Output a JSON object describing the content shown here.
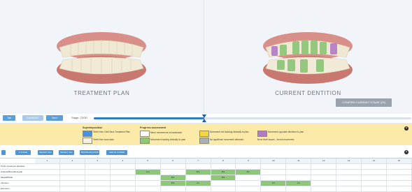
{
  "viewer": {
    "left_label": "TREATMENT PLAN",
    "right_label": "CURRENT DENTITION",
    "confirm_button": "CONFIRM CURRENT STAGE (23)"
  },
  "nav": {
    "btn1": "Tab",
    "btn2": "CURRENT",
    "btn3": "Next",
    "stage_label": "Stage: 23/30"
  },
  "legend": {
    "superimposition_title": "Superimposition",
    "superimposition_items": [
      "Teeth from ClinCheck Treatment Plan",
      "Teeth from scan data"
    ],
    "progress_title": "Progress assessment",
    "progress_items": [
      "Minor movements not assessed",
      "Movement tracking clinically to plan",
      "Movement not tracking clinically to plan",
      "No significant movement detected",
      "Movement opposite direction to plan",
      "Bone level issues - forced movement"
    ],
    "close": "×",
    "colors": {
      "plan_blue": "#4f8fe0",
      "scan_white": "#f4f1e6",
      "tracking_green": "#8fc77a",
      "not_tracking_yellow": "#f3d54a",
      "no_movement_gray": "#a9b0b7",
      "opposite_purple": "#b17ac4"
    }
  },
  "toolbar": {
    "buttons": [
      "A STAGE",
      "SELECT ALL",
      "SELECT ALL",
      "TRANSLATE ROW",
      "ADD IN LOWER"
    ],
    "close": "×"
  },
  "table": {
    "columns": [
      "1",
      "2",
      "3",
      "4",
      "5",
      "6",
      "7",
      "8",
      "9",
      "10",
      "11",
      "12",
      "13",
      "14",
      "15"
    ],
    "rows": [
      {
        "label": "Tooth movement direction",
        "cells": [
          "",
          "",
          "",
          "",
          "",
          "",
          "",
          "",
          "",
          "",
          "",
          "",
          "",
          "",
          ""
        ]
      },
      {
        "label": "Anterior/Buccal/Lingual",
        "cells": [
          "",
          "",
          "",
          "",
          "Lmj",
          "",
          "Bnt",
          "Bnt",
          "Bnt",
          "",
          "",
          "",
          "",
          "",
          ""
        ]
      },
      {
        "label": "Mesial/Distal",
        "cells": [
          "",
          "",
          "",
          "",
          "",
          "Bnt",
          "",
          "Bnt",
          "",
          "",
          "",
          "",
          "",
          "",
          ""
        ]
      },
      {
        "label": "Intrusion",
        "cells": [
          "",
          "",
          "",
          "",
          "",
          "Bnt",
          "Crt",
          "",
          "",
          "Crt",
          "Crt",
          "",
          "",
          "",
          ""
        ]
      },
      {
        "label": "Extrusion",
        "cells": [
          "",
          "",
          "",
          "",
          "",
          "",
          "",
          "",
          "",
          "",
          "",
          "",
          "",
          "",
          ""
        ]
      }
    ],
    "green_cells": [
      [
        1,
        4
      ],
      [
        1,
        6
      ],
      [
        1,
        7
      ],
      [
        1,
        8
      ],
      [
        2,
        5
      ],
      [
        2,
        7
      ],
      [
        3,
        5
      ],
      [
        3,
        6
      ],
      [
        3,
        9
      ],
      [
        3,
        10
      ]
    ]
  }
}
